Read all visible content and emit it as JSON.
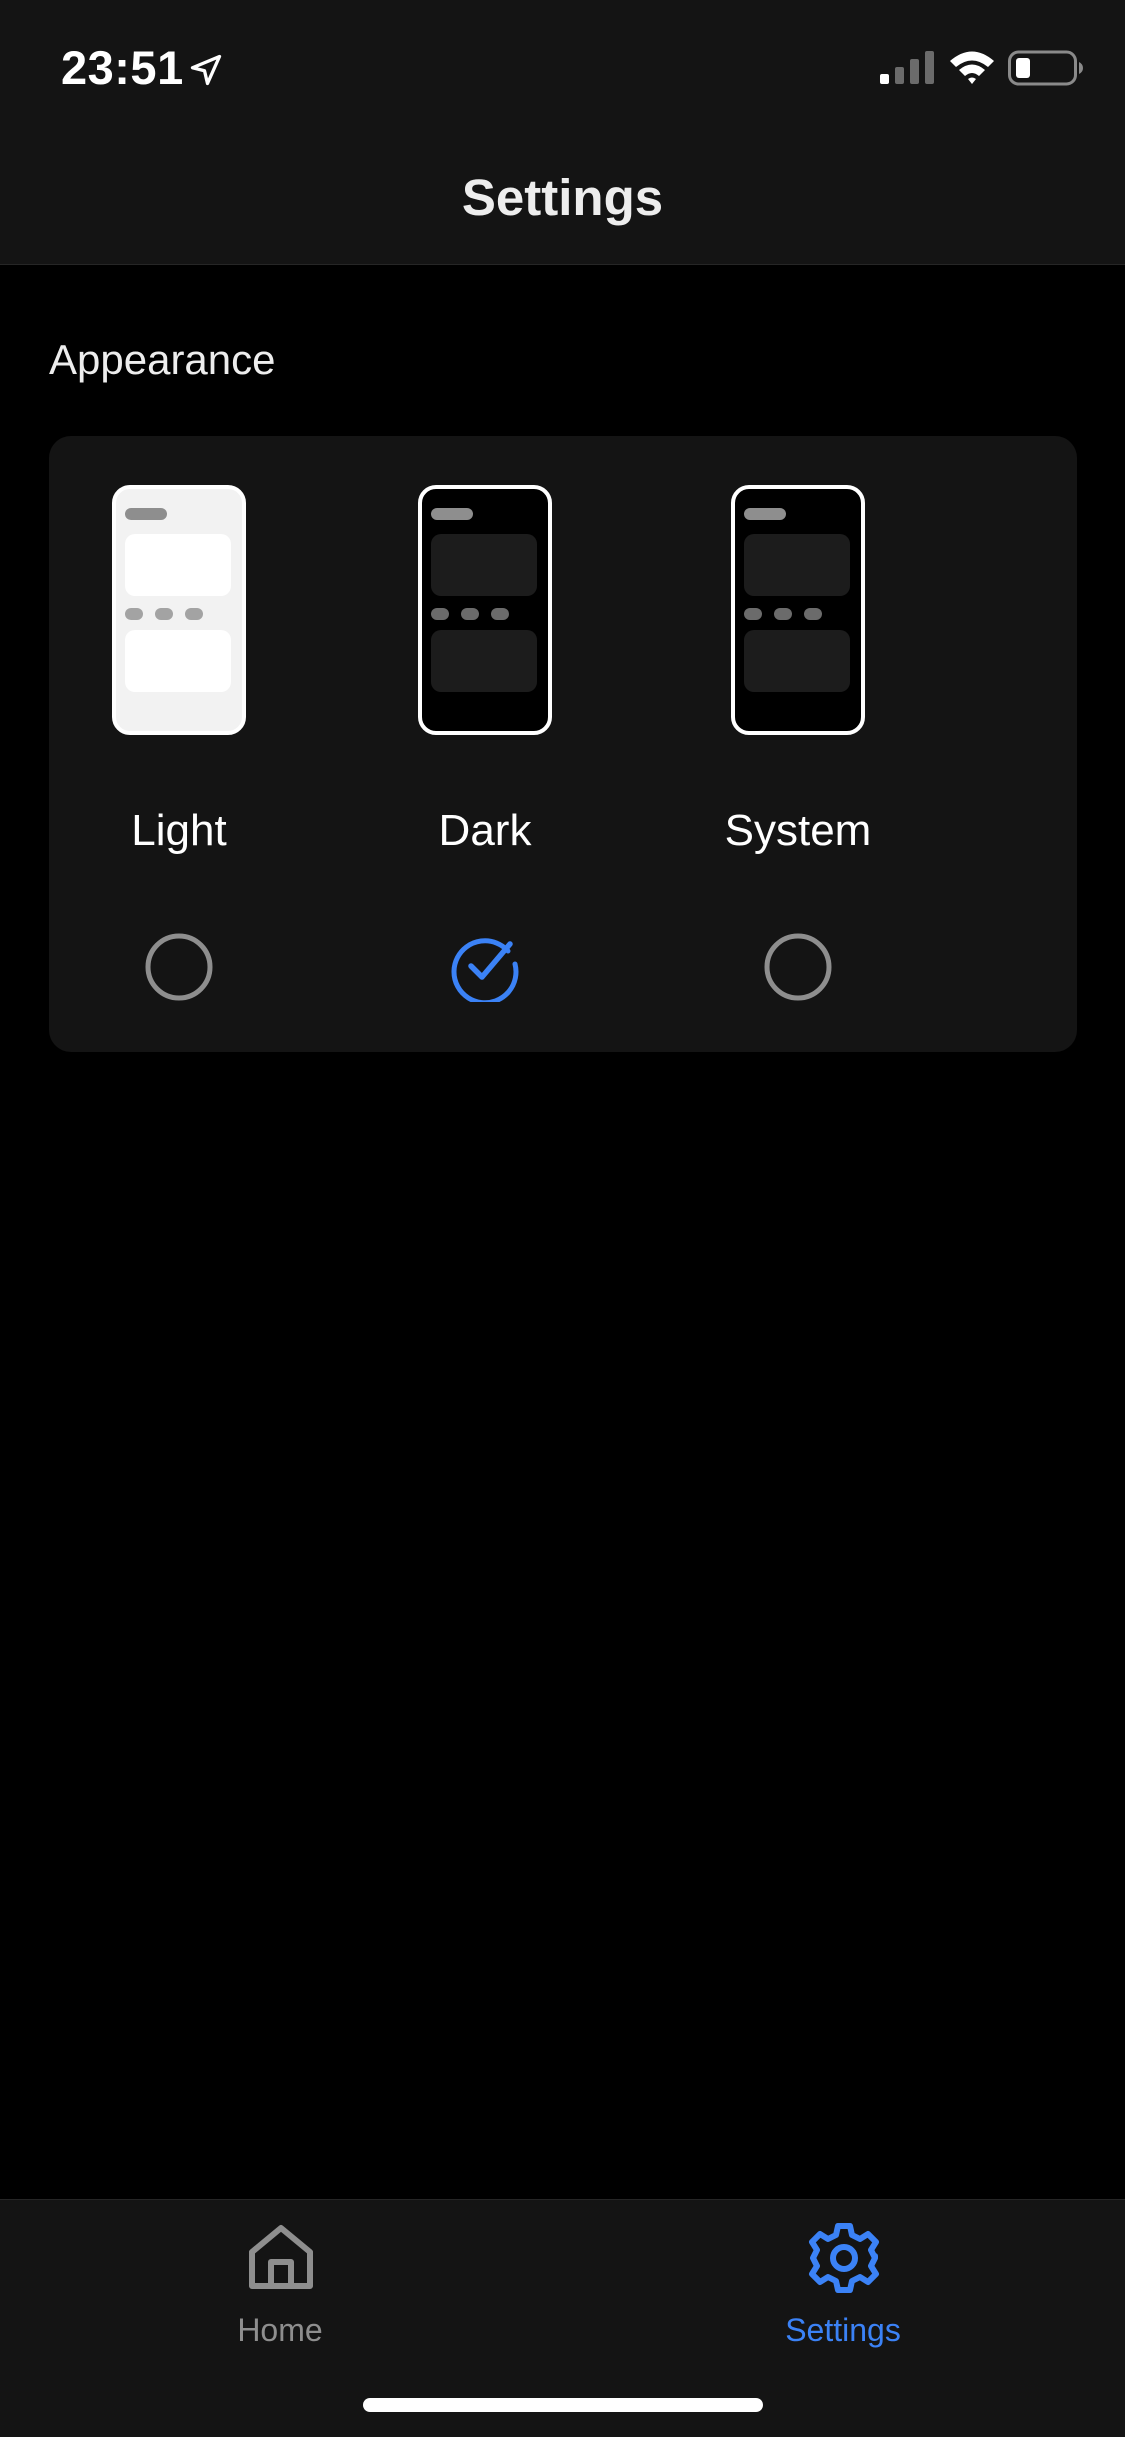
{
  "status_bar": {
    "time": "23:51",
    "location_icon": "location-arrow-icon",
    "signal_icon": "cellular-signal-icon",
    "wifi_icon": "wifi-icon",
    "battery_icon": "battery-icon"
  },
  "nav": {
    "title": "Settings"
  },
  "appearance": {
    "section_title": "Appearance",
    "selected": "Dark",
    "options": [
      {
        "label": "Light",
        "selected": false,
        "preview_icon": "light-phone-preview-icon"
      },
      {
        "label": "Dark",
        "selected": true,
        "preview_icon": "dark-phone-preview-icon"
      },
      {
        "label": "System",
        "selected": false,
        "preview_icon": "system-phone-preview-icon"
      }
    ]
  },
  "tab_bar": {
    "tabs": [
      {
        "label": "Home",
        "icon": "home-icon",
        "active": false
      },
      {
        "label": "Settings",
        "icon": "gear-icon",
        "active": true
      }
    ]
  },
  "colors": {
    "accent": "#3b82f6",
    "background": "#000000",
    "surface": "#141414",
    "inactive": "#8e8e8e"
  }
}
